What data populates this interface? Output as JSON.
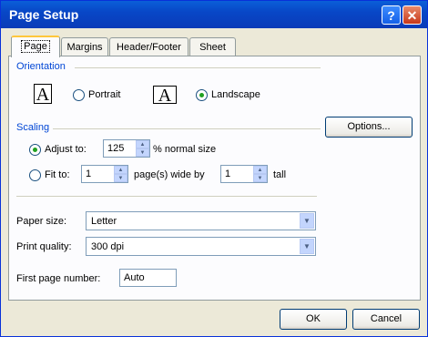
{
  "window": {
    "title": "Page Setup",
    "help_glyph": "?",
    "close_glyph": "✕"
  },
  "tabs": [
    {
      "label": "Page",
      "active": true
    },
    {
      "label": "Margins",
      "active": false
    },
    {
      "label": "Header/Footer",
      "active": false
    },
    {
      "label": "Sheet",
      "active": false
    }
  ],
  "orientation": {
    "group_label": "Orientation",
    "portrait": {
      "label": "Portrait",
      "checked": false,
      "icon_glyph": "A"
    },
    "landscape": {
      "label": "Landscape",
      "checked": true,
      "icon_glyph": "A"
    }
  },
  "scaling": {
    "group_label": "Scaling",
    "adjust_label": "Adjust to:",
    "adjust_value": "125",
    "adjust_suffix": "% normal size",
    "fit_label": "Fit to:",
    "fit_wide_value": "1",
    "fit_wide_suffix": "page(s) wide by",
    "fit_tall_value": "1",
    "fit_tall_suffix": "tall"
  },
  "paper_size": {
    "label": "Paper size:",
    "value": "Letter"
  },
  "print_quality": {
    "label": "Print quality:",
    "value": "300 dpi"
  },
  "first_page_number": {
    "label": "First page number:",
    "value": "Auto"
  },
  "buttons": {
    "options": "Options...",
    "ok": "OK",
    "cancel": "Cancel"
  },
  "colors": {
    "title_bar": "#0847c7",
    "group_label": "#0046d5",
    "dialog_bg": "#ece9d8"
  }
}
